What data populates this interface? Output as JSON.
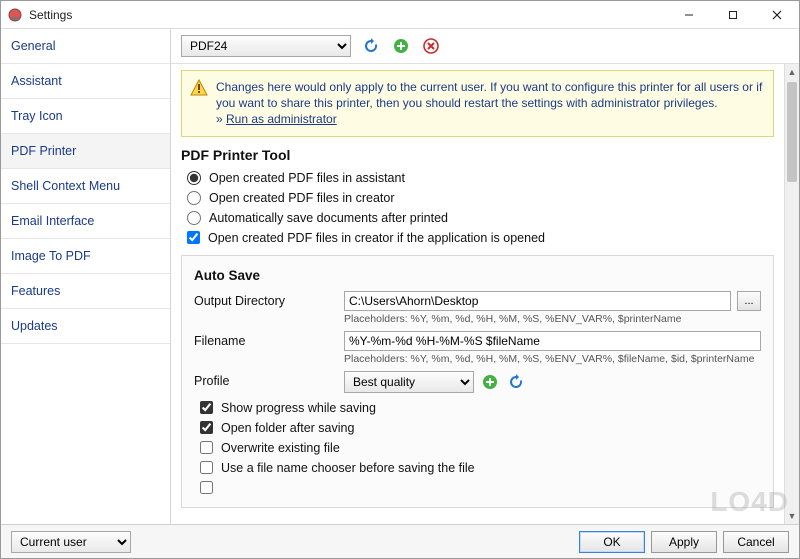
{
  "window": {
    "title": "Settings",
    "minimize_tip": "Minimize",
    "maximize_tip": "Maximize",
    "close_tip": "Close"
  },
  "sidebar": {
    "items": [
      {
        "label": "General"
      },
      {
        "label": "Assistant"
      },
      {
        "label": "Tray Icon"
      },
      {
        "label": "PDF Printer"
      },
      {
        "label": "Shell Context Menu"
      },
      {
        "label": "Email Interface"
      },
      {
        "label": "Image To PDF"
      },
      {
        "label": "Features"
      },
      {
        "label": "Updates"
      }
    ],
    "active_index": 3
  },
  "toolbar": {
    "printer_select_value": "PDF24",
    "refresh_tip": "Refresh",
    "add_tip": "Add",
    "remove_tip": "Remove"
  },
  "warning": {
    "text": "Changes here would only apply to the current user. If you want to configure this printer for all users or if you want to share this printer, then you should restart the settings with administrator privileges.",
    "link_prefix": "» ",
    "link_label": "Run as administrator"
  },
  "section_tool": {
    "title": "PDF Printer Tool",
    "radios": [
      {
        "label": "Open created PDF files in assistant",
        "checked": true
      },
      {
        "label": "Open created PDF files in creator",
        "checked": false
      },
      {
        "label": "Automatically save documents after printed",
        "checked": false
      }
    ],
    "checkbox": {
      "label": "Open created PDF files in creator if the application is opened",
      "checked": true
    }
  },
  "section_autosave": {
    "title": "Auto Save",
    "output_dir": {
      "label": "Output Directory",
      "value": "C:\\Users\\Ahorn\\Desktop",
      "browse_label": "...",
      "hint": "Placeholders: %Y, %m, %d, %H, %M, %S, %ENV_VAR%, $printerName"
    },
    "filename": {
      "label": "Filename",
      "value": "%Y-%m-%d %H-%M-%S $fileName",
      "hint": "Placeholders: %Y, %m, %d, %H, %M, %S, %ENV_VAR%, $fileName, $id, $printerName"
    },
    "profile": {
      "label": "Profile",
      "value": "Best quality",
      "add_tip": "Add profile",
      "refresh_tip": "Refresh profiles"
    },
    "checks": [
      {
        "label": "Show progress while saving",
        "checked": true
      },
      {
        "label": "Open folder after saving",
        "checked": true
      },
      {
        "label": "Overwrite existing file",
        "checked": false
      },
      {
        "label": "Use a file name chooser before saving the file",
        "checked": false
      }
    ]
  },
  "footer": {
    "scope_value": "Current user",
    "ok": "OK",
    "apply": "Apply",
    "cancel": "Cancel"
  },
  "watermark": "LO4D"
}
